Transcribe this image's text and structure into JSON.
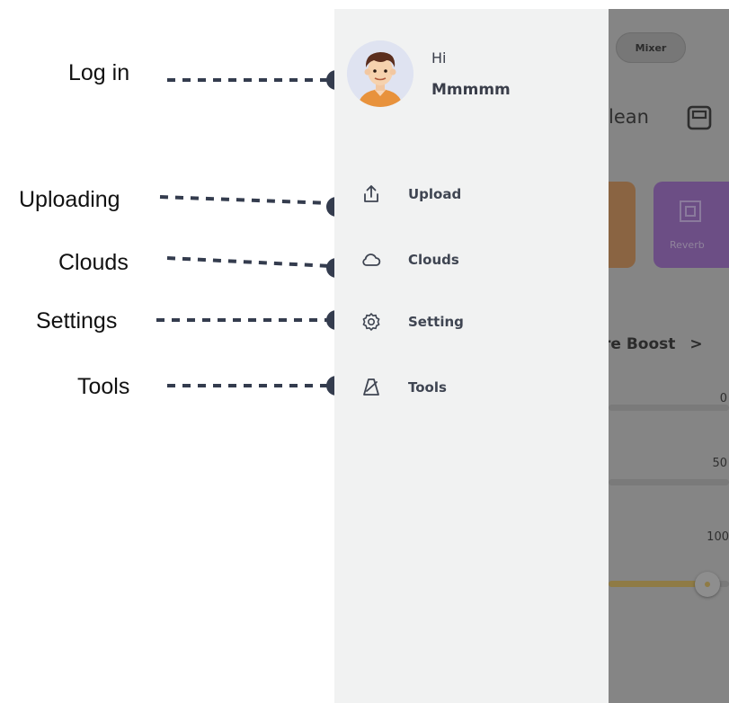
{
  "callouts": [
    {
      "id": "login",
      "text": "Log in"
    },
    {
      "id": "uploading",
      "text": "Uploading"
    },
    {
      "id": "clouds",
      "text": "Clouds"
    },
    {
      "id": "settings",
      "text": "Settings"
    },
    {
      "id": "tools",
      "text": "Tools"
    }
  ],
  "drawer": {
    "greeting": "Hi",
    "username": "Mmmmm",
    "menu": [
      {
        "label": "Upload",
        "icon": "upload-icon"
      },
      {
        "label": "Clouds",
        "icon": "cloud-icon"
      },
      {
        "label": "Setting",
        "icon": "gear-icon"
      },
      {
        "label": "Tools",
        "icon": "metronome-icon"
      }
    ]
  },
  "background_app": {
    "mixer_label": "Mixer",
    "preset_name": "lean",
    "effect_label": "Reverb",
    "section_title": "re Boost",
    "chevron": ">",
    "slider_values": [
      "0",
      "50",
      "100"
    ],
    "active_slider_level": 1.0
  },
  "colors": {
    "drawer_bg": "#f1f2f2",
    "overlay": "#858585",
    "menu_text": "#3f4552",
    "callout_dot": "#343c4e",
    "accent_orange": "#e8923c",
    "accent_purple": "#9a5ed0",
    "accent_gold": "#d9b24a"
  }
}
